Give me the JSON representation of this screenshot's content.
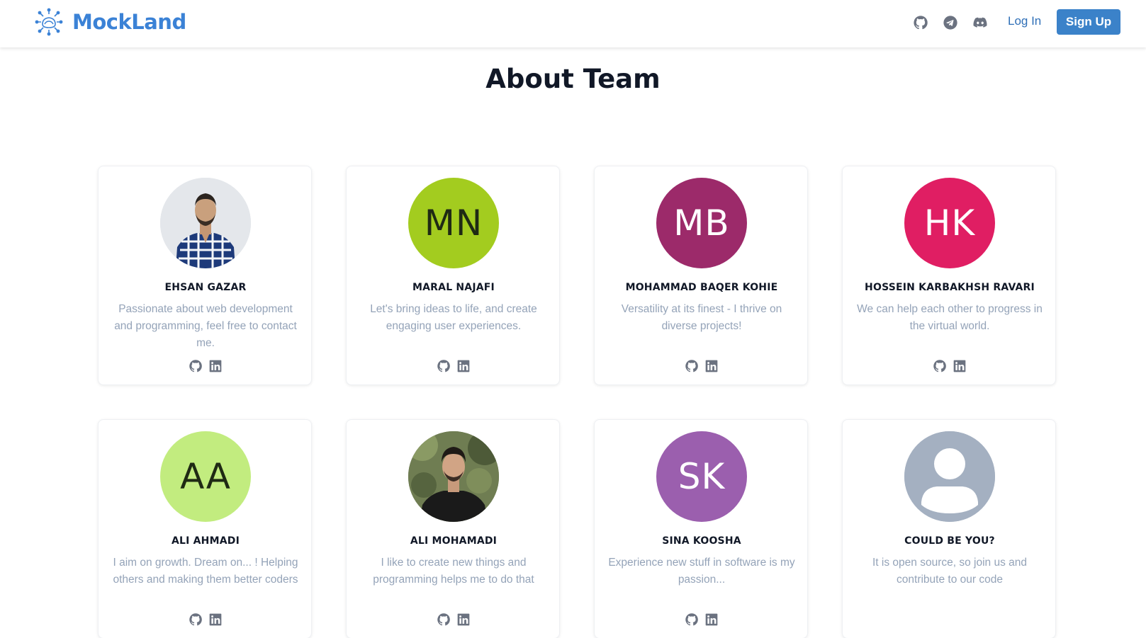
{
  "brand": {
    "name": "MockLand",
    "color": "#3b82d6"
  },
  "nav": {
    "icons": [
      "github-icon",
      "telegram-icon",
      "discord-icon"
    ],
    "login_label": "Log In",
    "signup_label": "Sign Up"
  },
  "page": {
    "title": "About Team"
  },
  "members": [
    {
      "name": "EHSAN GAZAR",
      "bio": "Passionate about web development and programming, feel free to contact me.",
      "avatar": {
        "type": "photo",
        "initials": "",
        "bg": "#dfe3e8",
        "fg": "#ffffff"
      },
      "socials": [
        "github-icon",
        "linkedin-icon"
      ]
    },
    {
      "name": "MARAL NAJAFI",
      "bio": "Let's bring ideas to life, and create engaging user experiences.",
      "avatar": {
        "type": "initials",
        "initials": "MN",
        "bg": "#a3cc1f",
        "fg": "#1f2a14"
      },
      "socials": [
        "github-icon",
        "linkedin-icon"
      ]
    },
    {
      "name": "MOHAMMAD BAQER KOHIE",
      "bio": "Versatility at its finest - I thrive on diverse projects!",
      "avatar": {
        "type": "initials",
        "initials": "MB",
        "bg": "#9c2a6a",
        "fg": "#ffffff"
      },
      "socials": [
        "github-icon",
        "linkedin-icon"
      ]
    },
    {
      "name": "HOSSEIN KARBAKHSH RAVARI",
      "bio": "We can help each other to progress in the virtual world.",
      "avatar": {
        "type": "initials",
        "initials": "HK",
        "bg": "#e01e63",
        "fg": "#ffffff"
      },
      "socials": [
        "github-icon",
        "linkedin-icon"
      ]
    },
    {
      "name": "ALI AHMADI",
      "bio": "I aim on growth. Dream on... ! Helping others and making them better coders",
      "avatar": {
        "type": "initials",
        "initials": "AA",
        "bg": "#c2ec7f",
        "fg": "#1f2a14"
      },
      "socials": [
        "github-icon",
        "linkedin-icon"
      ]
    },
    {
      "name": "ALI MOHAMADI",
      "bio": "I like to create new things and programming helps me to do that",
      "avatar": {
        "type": "photo",
        "initials": "",
        "bg": "#5b6b45",
        "fg": "#ffffff"
      },
      "socials": [
        "github-icon",
        "linkedin-icon"
      ]
    },
    {
      "name": "SINA KOOSHA",
      "bio": "Experience new stuff in software is my passion...",
      "avatar": {
        "type": "initials",
        "initials": "SK",
        "bg": "#9b5fae",
        "fg": "#ffffff"
      },
      "socials": [
        "github-icon",
        "linkedin-icon"
      ]
    },
    {
      "name": "COULD BE YOU?",
      "bio": "It is open source, so join us and contribute to our code",
      "avatar": {
        "type": "placeholder",
        "initials": "",
        "bg": "#a4b0c1",
        "fg": "#ffffff"
      },
      "socials": []
    }
  ]
}
